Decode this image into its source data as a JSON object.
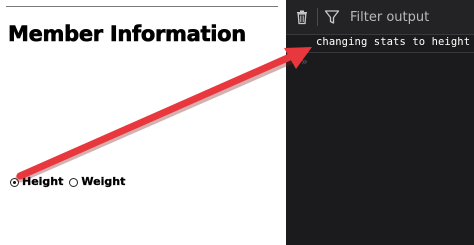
{
  "page": {
    "title": "Member Information",
    "radio_options": [
      {
        "label": "Height",
        "selected": true
      },
      {
        "label": "Weight",
        "selected": false
      }
    ]
  },
  "console": {
    "toolbar": {
      "clear_icon": "trash-icon",
      "filter_icon": "funnel-icon",
      "filter_placeholder": "Filter output"
    },
    "log_messages": [
      "changing stats to height"
    ],
    "prompt_symbol": "»"
  },
  "annotation": {
    "arrow_color": "#e8383d",
    "arrow_icon": "arrow-annotation"
  },
  "colors": {
    "console_background": "#1b1b1d",
    "console_toolbar": "#232325",
    "page_background": "#ffffff"
  }
}
